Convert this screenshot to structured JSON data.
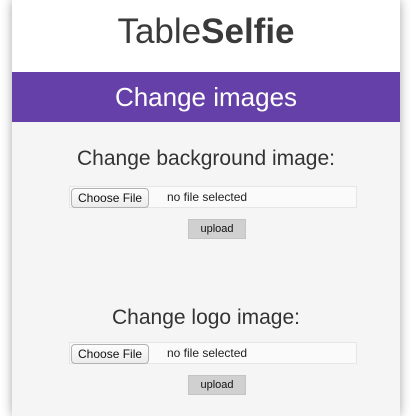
{
  "header": {
    "brand_regular": "Table",
    "brand_bold": "Selfie"
  },
  "banner": {
    "title": "Change images"
  },
  "sections": [
    {
      "title": "Change background image:",
      "choose_label": "Choose File",
      "file_status": "no file selected",
      "upload_label": "upload"
    },
    {
      "title": "Change logo image:",
      "choose_label": "Choose File",
      "file_status": "no file selected",
      "upload_label": "upload"
    }
  ],
  "colors": {
    "banner": "#6440a8",
    "page": "#f5f5f5"
  }
}
